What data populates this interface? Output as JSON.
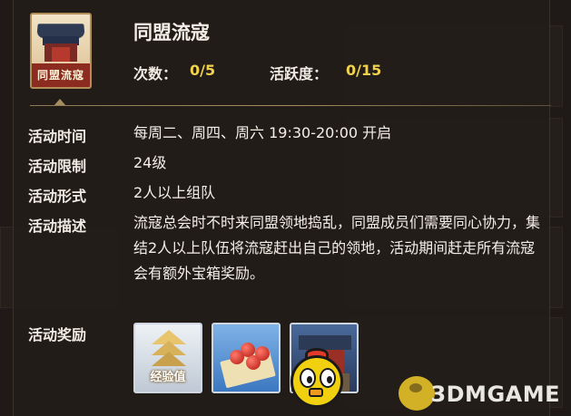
{
  "activity": {
    "icon_label": "同盟流寇",
    "title": "同盟流寇",
    "count_label": "次数：",
    "count_value": "0/5",
    "activity_label": "活跃度：",
    "activity_value": "0/15"
  },
  "details": [
    {
      "key": "活动时间",
      "value": "每周二、周四、周六 19:30-20:00 开启"
    },
    {
      "key": "活动限制",
      "value": "24级"
    },
    {
      "key": "活动形式",
      "value": "2人以上组队"
    },
    {
      "key": "活动描述",
      "value": "流寇总会时不时来同盟领地捣乱，同盟成员们需要同心协力，集结2人以上队伍将流寇赶出自己的领地，活动期间赶走所有流寇会有额外宝箱奖励。"
    }
  ],
  "rewards_label": "活动奖励",
  "rewards": [
    {
      "name": "经验值",
      "icon": "experience-icon"
    },
    {
      "name": "",
      "icon": "red-balls-cloth-icon"
    },
    {
      "name": "",
      "icon": "castle-icon"
    }
  ],
  "watermark": "3DMGAME",
  "colors": {
    "accent_yellow": "#f2d14b",
    "panel_bg": "#221d1a",
    "divider": "#a58d5e"
  }
}
